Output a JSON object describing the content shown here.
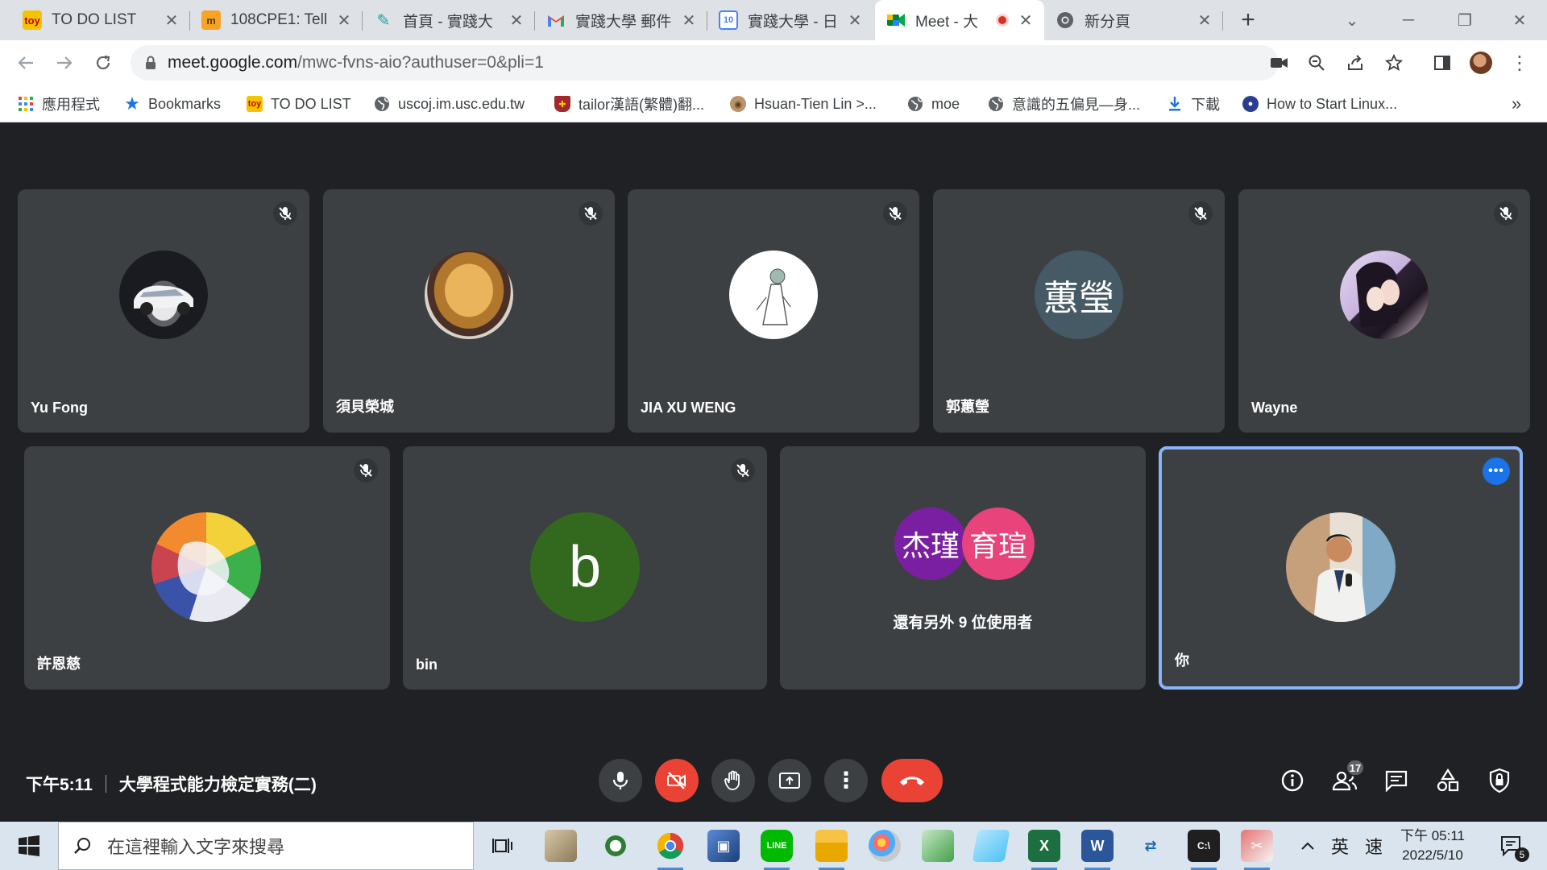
{
  "browser": {
    "tabs": [
      {
        "title": "TO DO LIST",
        "icon": "todo-icon",
        "active": false
      },
      {
        "title": "108CPE1: Tell",
        "icon": "moodle-icon",
        "active": false
      },
      {
        "title": "首頁 - 實踐大",
        "icon": "feather-icon",
        "active": false
      },
      {
        "title": "實踐大學 郵件",
        "icon": "gmail-icon",
        "active": false
      },
      {
        "title": "實踐大學 - 日",
        "icon": "calendar-icon",
        "active": false
      },
      {
        "title": "Meet - 大",
        "icon": "meet-icon",
        "active": true
      },
      {
        "title": "新分頁",
        "icon": "chrome-icon",
        "active": false
      }
    ],
    "url_host": "meet.google.com",
    "url_path": "/mwc-fvns-aio?authuser=0&pli=1",
    "bookmarks": [
      {
        "label": "應用程式",
        "icon": "apps-grid-icon"
      },
      {
        "label": "Bookmarks",
        "icon": "star-icon"
      },
      {
        "label": "TO DO LIST",
        "icon": "todo-icon"
      },
      {
        "label": "uscoj.im.usc.edu.tw",
        "icon": "globe-icon"
      },
      {
        "label": "tailor漢語(繁體)翻...",
        "icon": "shield-crest-icon"
      },
      {
        "label": "Hsuan-Tien Lin >...",
        "icon": "seal-icon"
      },
      {
        "label": "moe",
        "icon": "globe-icon"
      },
      {
        "label": "意識的五偏見—身...",
        "icon": "globe-icon"
      },
      {
        "label": "下載",
        "icon": "download-icon"
      },
      {
        "label": "How to Start Linux...",
        "icon": "linux-icon"
      }
    ],
    "more_bookmarks": "»"
  },
  "meet": {
    "participants": [
      {
        "name": "Yu Fong",
        "avatar_initials": "",
        "avatar_kind": "car-photo",
        "muted": true
      },
      {
        "name": "須貝榮城",
        "avatar_initials": "",
        "avatar_kind": "food-photo",
        "muted": true
      },
      {
        "name": "JIA XU WENG",
        "avatar_initials": "",
        "avatar_kind": "sketch-photo",
        "muted": true
      },
      {
        "name": "郭蕙瑩",
        "avatar_initials": "蕙瑩",
        "avatar_kind": "initials",
        "avatar_color": "#455a64",
        "muted": true
      },
      {
        "name": "Wayne",
        "avatar_initials": "",
        "avatar_kind": "anime-photo",
        "muted": true
      },
      {
        "name": "許恩慈",
        "avatar_initials": "",
        "avatar_kind": "paint-photo",
        "muted": true
      },
      {
        "name": "bin",
        "avatar_initials": "b",
        "avatar_kind": "initials",
        "avatar_color": "#33691e",
        "muted": true
      }
    ],
    "others_tile": {
      "avatars": [
        {
          "initials": "杰瑾",
          "color": "#7b1fa2"
        },
        {
          "initials": "育瑄",
          "color": "#e8437a"
        }
      ],
      "label": "還有另外 9 位使用者"
    },
    "self_tile": {
      "name": "你",
      "avatar_kind": "speaker-photo"
    },
    "time": "下午5:11",
    "meeting_title": "大學程式能力檢定實務(二)",
    "people_count": "17",
    "accent_red": "#ea4335",
    "accent_blue": "#8ab4f8"
  },
  "taskbar": {
    "search_placeholder": "在這裡輸入文字來搜尋",
    "ime_lang": "英",
    "ime_mode": "速",
    "clock_time": "下午 05:11",
    "clock_date": "2022/5/10",
    "notification_count": "5"
  }
}
